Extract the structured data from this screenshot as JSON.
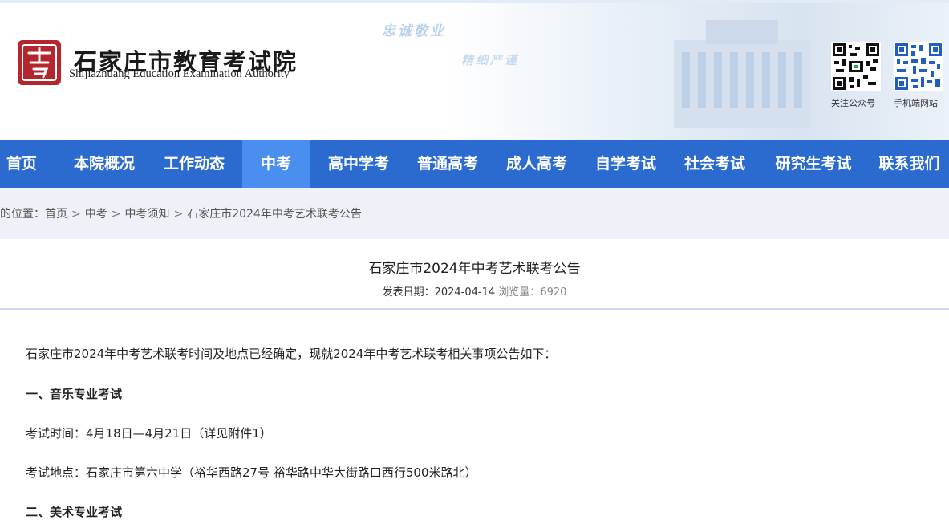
{
  "header": {
    "title": "石家庄市教育考试院",
    "subtitle": "Shijiazhuang Education Examination Authority",
    "slogan_1": "忠诚敬业",
    "slogan_2": "精细严谨",
    "qr_1_label": "关注公众号",
    "qr_2_label": "手机端网站"
  },
  "nav": {
    "items": [
      {
        "label": "首页"
      },
      {
        "label": "本院概况"
      },
      {
        "label": "工作动态"
      },
      {
        "label": "中考"
      },
      {
        "label": "高中学考"
      },
      {
        "label": "普通高考"
      },
      {
        "label": "成人高考"
      },
      {
        "label": "自学考试"
      },
      {
        "label": "社会考试"
      },
      {
        "label": "研究生考试"
      },
      {
        "label": "联系我们"
      }
    ],
    "active": "中考"
  },
  "breadcrumb": {
    "prefix": "的位置：",
    "items": [
      "首页",
      "中考",
      "中考须知",
      "石家庄市2024年中考艺术联考公告"
    ],
    "separator": ">"
  },
  "article": {
    "title": "石家庄市2024年中考艺术联考公告",
    "date_label": "发表日期：",
    "date": "2024-04-14",
    "views_label": "浏览量：",
    "views": "6920",
    "paragraphs": [
      "石家庄市2024年中考艺术联考时间及地点已经确定，现就2024年中考艺术联考相关事项公告如下：",
      "一、音乐专业考试",
      "考试时间：4月18日—4月21日（详见附件1）",
      "考试地点：石家庄市第六中学（裕华西路27号 裕华路中华大街路口西行500米路北）",
      "二、美术专业考试"
    ]
  },
  "colors": {
    "nav_bg": "#2b6bd0",
    "nav_active": "#4a8ef0",
    "crumb_bg": "#eef2f8",
    "logo_red": "#b3262e"
  }
}
